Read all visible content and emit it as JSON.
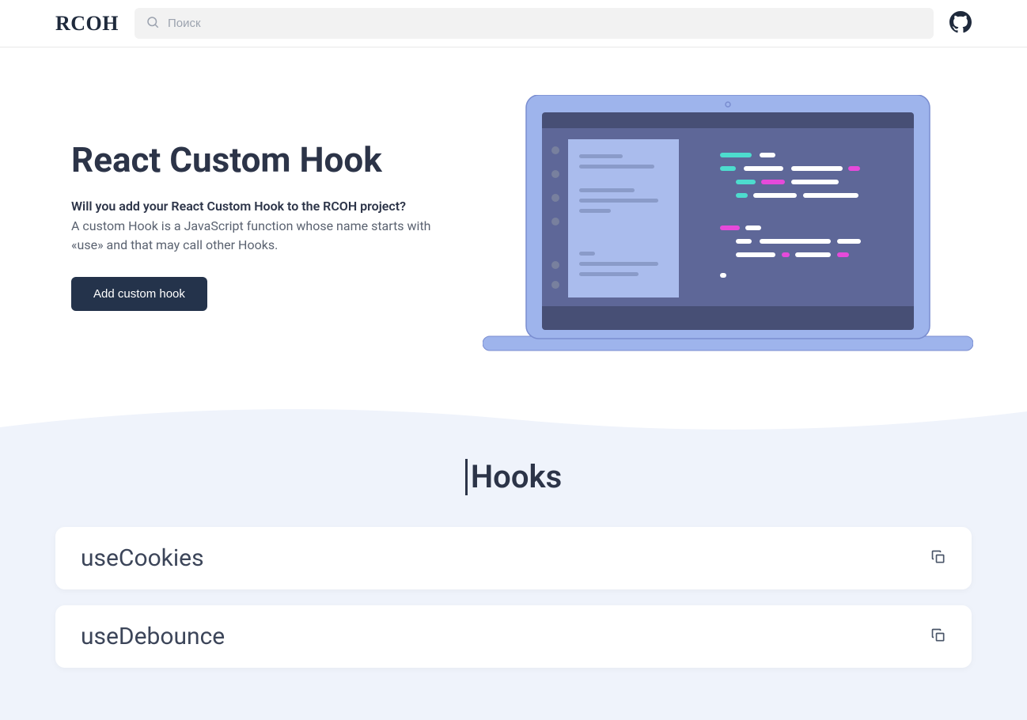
{
  "header": {
    "logo": "RCOH",
    "search_placeholder": "Поиск"
  },
  "hero": {
    "title": "React Custom Hook",
    "subtitle": "Will you add your React Custom Hook to the RCOH project?",
    "description": "A custom Hook is a JavaScript function whose name starts with «use» and that may call other Hooks.",
    "cta_label": "Add custom hook"
  },
  "hooks_section": {
    "heading": "Hooks",
    "items": [
      {
        "name": "useCookies"
      },
      {
        "name": "useDebounce"
      }
    ]
  },
  "colors": {
    "primary_dark": "#24334b",
    "text_dark": "#2c3448",
    "text_muted": "#5a6270",
    "bg_light": "#eff3fb",
    "accent_blue": "#aabced",
    "laptop_frame": "#9eb4ec",
    "laptop_screen": "#5e6798",
    "laptop_panel": "#aabced",
    "code_cyan": "#4ddcce",
    "code_magenta": "#e54ada",
    "code_white": "#ffffff"
  }
}
